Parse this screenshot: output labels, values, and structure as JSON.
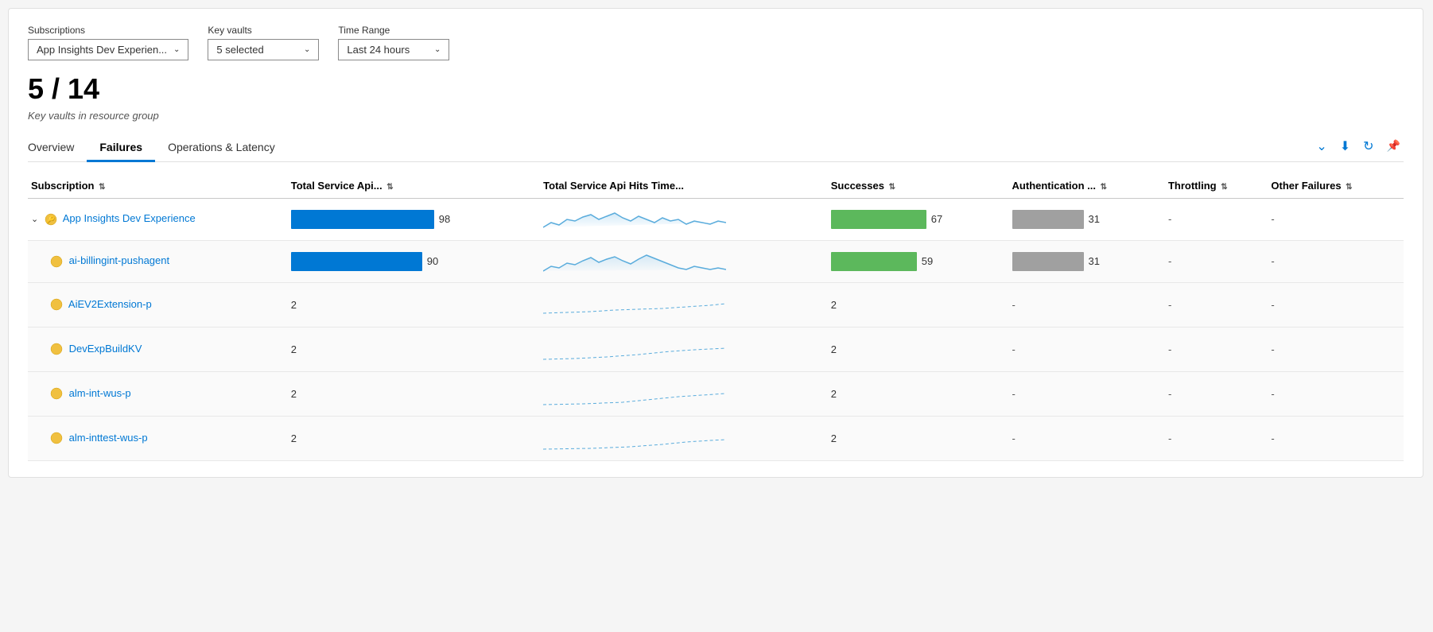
{
  "filters": {
    "subscriptions_label": "Subscriptions",
    "subscriptions_value": "App Insights Dev Experien...",
    "keyvaults_label": "Key vaults",
    "keyvaults_value": "5 selected",
    "timerange_label": "Time Range",
    "timerange_value": "Last 24 hours"
  },
  "summary": {
    "count": "5 / 14",
    "description": "Key vaults in resource group"
  },
  "tabs": [
    {
      "id": "overview",
      "label": "Overview",
      "active": false
    },
    {
      "id": "failures",
      "label": "Failures",
      "active": true
    },
    {
      "id": "operations",
      "label": "Operations & Latency",
      "active": false
    }
  ],
  "tab_actions": {
    "collapse_icon": "⌄",
    "download_icon": "⬇",
    "refresh_icon": "↺",
    "pin_icon": "📌"
  },
  "table": {
    "columns": [
      {
        "id": "subscription",
        "label": "Subscription",
        "sortable": true
      },
      {
        "id": "total_api",
        "label": "Total Service Api...",
        "sortable": true
      },
      {
        "id": "total_api_time",
        "label": "Total Service Api Hits Time...",
        "sortable": false
      },
      {
        "id": "successes",
        "label": "Successes",
        "sortable": true
      },
      {
        "id": "auth",
        "label": "Authentication ...",
        "sortable": true
      },
      {
        "id": "throttling",
        "label": "Throttling",
        "sortable": true
      },
      {
        "id": "other_failures",
        "label": "Other Failures",
        "sortable": true
      }
    ],
    "rows": [
      {
        "id": "app-insights",
        "type": "parent",
        "name": "App Insights Dev Experience",
        "total_api": 98,
        "bar_total_width": 180,
        "successes": 67,
        "bar_success_width": 120,
        "auth": 31,
        "bar_auth_width": 90,
        "throttling": "-",
        "other_failures": "-",
        "expanded": true
      },
      {
        "id": "ai-billingint",
        "type": "child",
        "name": "ai-billingint-pushagent",
        "total_api": 90,
        "bar_total_width": 165,
        "successes": 59,
        "bar_success_width": 108,
        "auth": 31,
        "bar_auth_width": 90,
        "throttling": "-",
        "other_failures": "-"
      },
      {
        "id": "aiev2extension",
        "type": "child",
        "name": "AiEV2Extension-p",
        "total_api": 2,
        "bar_total_width": 0,
        "successes": 2,
        "bar_success_width": 0,
        "auth": "-",
        "bar_auth_width": 0,
        "throttling": "-",
        "other_failures": "-"
      },
      {
        "id": "devexpbuildkv",
        "type": "child",
        "name": "DevExpBuildKV",
        "total_api": 2,
        "bar_total_width": 0,
        "successes": 2,
        "bar_success_width": 0,
        "auth": "-",
        "bar_auth_width": 0,
        "throttling": "-",
        "other_failures": "-"
      },
      {
        "id": "alm-int-wus",
        "type": "child",
        "name": "alm-int-wus-p",
        "total_api": 2,
        "bar_total_width": 0,
        "successes": 2,
        "bar_success_width": 0,
        "auth": "-",
        "bar_auth_width": 0,
        "throttling": "-",
        "other_failures": "-"
      },
      {
        "id": "alm-inttest-wus",
        "type": "child",
        "name": "alm-inttest-wus-p",
        "total_api": 2,
        "bar_total_width": 0,
        "successes": 2,
        "bar_success_width": 0,
        "auth": "-",
        "bar_auth_width": 0,
        "throttling": "-",
        "other_failures": "-"
      }
    ]
  }
}
